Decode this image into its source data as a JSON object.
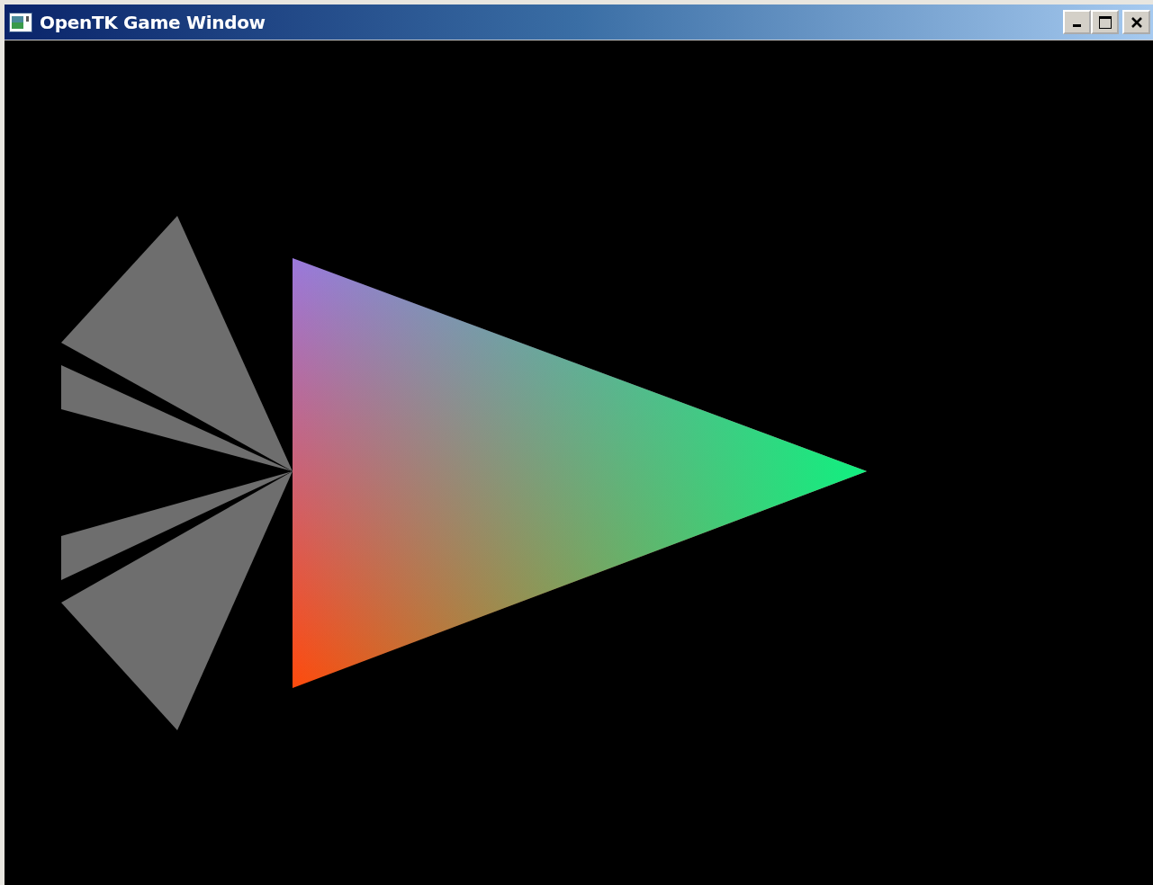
{
  "window": {
    "title": "OpenTK Game Window"
  }
}
